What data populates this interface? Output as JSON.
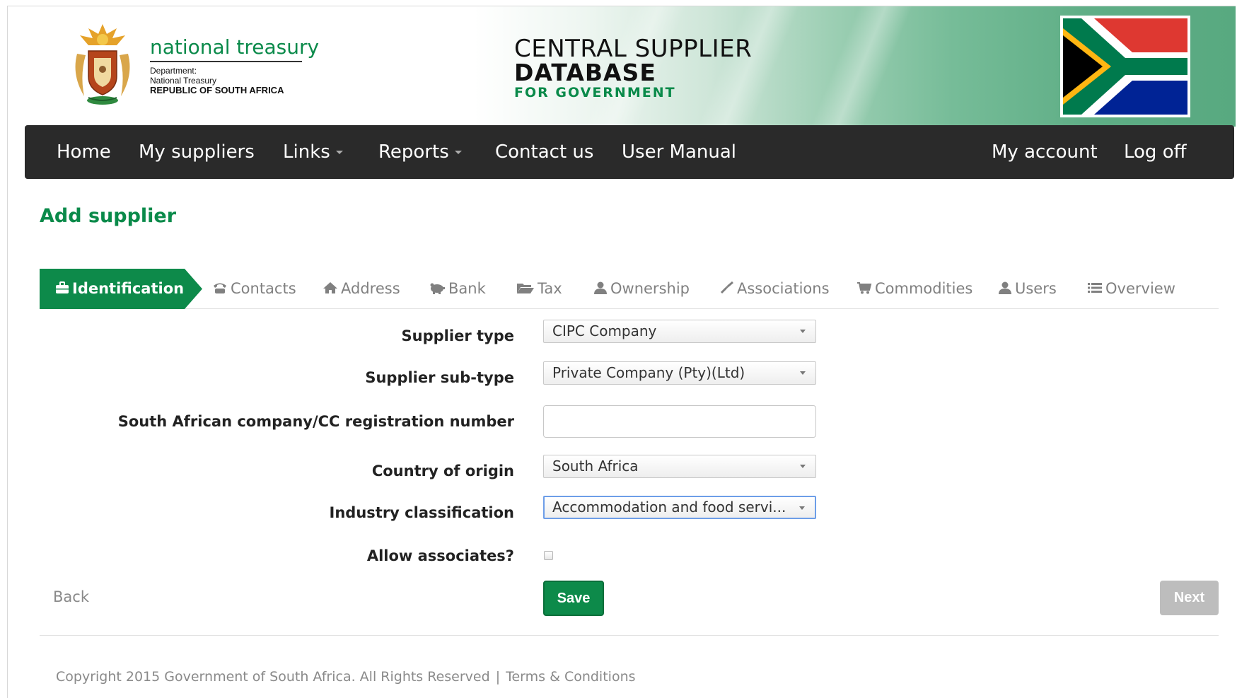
{
  "header": {
    "org_title": "national treasury",
    "org_line1": "Department:",
    "org_line2": "National Treasury",
    "org_line3": "REPUBLIC OF SOUTH AFRICA",
    "system_line1": "CENTRAL SUPPLIER",
    "system_line2": "DATABASE",
    "system_line3": "FOR GOVERNMENT"
  },
  "nav": {
    "left": [
      {
        "label": "Home"
      },
      {
        "label": "My suppliers"
      },
      {
        "label": "Links",
        "dropdown": true
      },
      {
        "label": "Reports",
        "dropdown": true
      },
      {
        "label": "Contact us"
      },
      {
        "label": "User Manual"
      }
    ],
    "right": [
      {
        "label": "My account"
      },
      {
        "label": "Log off"
      }
    ]
  },
  "page_title": "Add supplier",
  "tabs": [
    {
      "label": "Identification",
      "icon": "briefcase-icon",
      "active": true
    },
    {
      "label": "Contacts",
      "icon": "phone-icon"
    },
    {
      "label": "Address",
      "icon": "home-icon"
    },
    {
      "label": "Bank",
      "icon": "piggy-bank-icon"
    },
    {
      "label": "Tax",
      "icon": "folder-open-icon"
    },
    {
      "label": "Ownership",
      "icon": "user-icon"
    },
    {
      "label": "Associations",
      "icon": "link-icon"
    },
    {
      "label": "Commodities",
      "icon": "cart-icon"
    },
    {
      "label": "Users",
      "icon": "user-icon"
    },
    {
      "label": "Overview",
      "icon": "list-icon"
    }
  ],
  "form": {
    "supplier_type": {
      "label": "Supplier type",
      "value": "CIPC Company"
    },
    "supplier_subtype": {
      "label": "Supplier sub-type",
      "value": "Private Company (Pty)(Ltd)"
    },
    "registration_number": {
      "label": "South African company/CC registration number",
      "value": ""
    },
    "country_of_origin": {
      "label": "Country of origin",
      "value": "South Africa"
    },
    "industry_classification": {
      "label": "Industry classification",
      "value": "Accommodation and food servi..."
    },
    "allow_associates": {
      "label": "Allow associates?",
      "checked": false
    }
  },
  "actions": {
    "back": "Back",
    "save": "Save",
    "next": "Next"
  },
  "footer": {
    "copyright": "Copyright 2015 Government of South Africa. All Rights Reserved",
    "separator": "|",
    "terms": "Terms & Conditions"
  },
  "colors": {
    "accent_green": "#0d8a4a",
    "navbar": "#2a2a2a",
    "muted_text": "#8a8a8a"
  }
}
